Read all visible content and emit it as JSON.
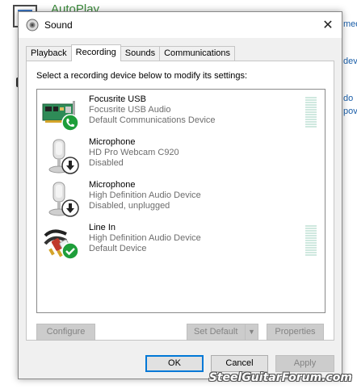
{
  "background": {
    "title": "AutoPlay",
    "side_fragments": [
      "medi",
      "dev",
      "do",
      "pov"
    ],
    "watermark": "SteelGuitarForum.com"
  },
  "dialog": {
    "title": "Sound",
    "close_glyph": "✕",
    "tabs": [
      {
        "label": "Playback",
        "active": false
      },
      {
        "label": "Recording",
        "active": true
      },
      {
        "label": "Sounds",
        "active": false
      },
      {
        "label": "Communications",
        "active": false
      }
    ],
    "instruction": "Select a recording device below to modify its settings:",
    "devices": [
      {
        "name": "Focusrite USB",
        "line2": "Focusrite USB Audio",
        "line3": "Default Communications Device",
        "icon": "sound-card-icon",
        "badge": "phone-badge",
        "has_meter": true
      },
      {
        "name": "Microphone",
        "line2": "HD Pro Webcam C920",
        "line3": "Disabled",
        "icon": "microphone-icon",
        "badge": "down-arrow-badge",
        "has_meter": false
      },
      {
        "name": "Microphone",
        "line2": "High Definition Audio Device",
        "line3": "Disabled, unplugged",
        "icon": "microphone-icon",
        "badge": "down-arrow-badge",
        "has_meter": false
      },
      {
        "name": "Line In",
        "line2": "High Definition Audio Device",
        "line3": "Default Device",
        "icon": "rca-cable-icon",
        "badge": "check-badge",
        "has_meter": true
      }
    ],
    "buttons": {
      "configure": "Configure",
      "set_default": "Set Default",
      "properties": "Properties",
      "ok": "OK",
      "cancel": "Cancel",
      "apply": "Apply"
    }
  },
  "colors": {
    "accent": "#0078d7",
    "meter": "#cfe8df",
    "check_badge": "#1e9e3a",
    "phone_badge": "#1e9e3a"
  }
}
